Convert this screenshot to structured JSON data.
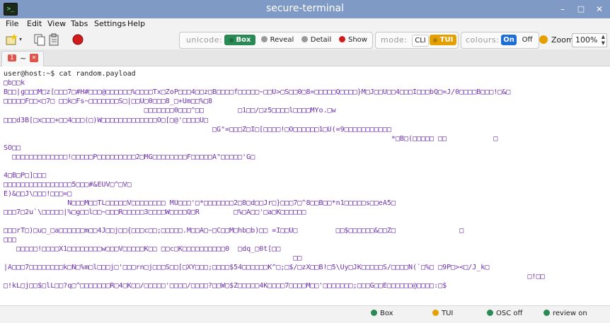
{
  "window": {
    "title": "secure-terminal",
    "minimize": "–",
    "restore": "□",
    "close": "✕"
  },
  "menu": [
    {
      "label": "File"
    },
    {
      "label": "Edit"
    },
    {
      "label": "View"
    },
    {
      "label": "Tabs"
    },
    {
      "label": "Settings"
    },
    {
      "label": "Help"
    }
  ],
  "toolbar": {
    "unicode": {
      "label": "unicode:",
      "box": "Box",
      "reveal": "Reveal",
      "detail": "Detail",
      "show": "Show"
    },
    "mode": {
      "label": "mode:",
      "cli": "CLI",
      "tui": "TUI"
    },
    "colours": {
      "label": "colours:",
      "on": "On",
      "off": "Off"
    },
    "zoom": {
      "label": "Zoom",
      "value": "100%"
    }
  },
  "tab": {
    "number": "1",
    "name": "~",
    "close": "✕"
  },
  "terminal": {
    "lines": [
      "user@host:~$ cat random.payload",
      "□b□□k",
      "B□□|g□□□M□z[□□□7□#H#□□□@□□□□□□%□□□□Tx□ZoP□□□4□□z□B□□□□f□□□□□~□□U>□S□□0□8=□□□□□Q□□□□}M□J□□U□□4□□□I□□□bQ□=J/0□□□□B□□□!□&□",
      "□□□□□F□□<□7□ □□k□Fs~□□□□□□□S□|□□U□0□□□8_□+Um□□%□8",
      "                                 □□□□□□□0□□□^□□        □1□□/□z5□□□□l□□□□MYo.□w",
      "□□□d3B[□x□□□+□□4□□□(□)W□□□□□□□□□□□□□O□[□@'□□□□U□",
      "                                                 □G\"=□□□Z□I□[□□□□!□O□□□□□□1□U(=9□□□□□□□□□□□",
      "                                                                                           *□B□(□□□□□ □□           □",
      "SO□□",
      "  □□□□□□□□□□□□□!□□□□□P□□□□□□□□□2□MG□□□□□□□□F□□□□□A\"□□□□□'G□",
      "",
      "4□B□P□]□□□",
      "□□□□□□□□□□□□□□□□5□□□#&EUV□^□V□",
      "E)&□□J\\□□□!□□□=□",
      "               N□□□M□□TL□□□□□V□□□□□□□□ MU□□□'□*□□□□□□□2□8□d□□Jr□}□□□7□^8□□B□□*n1□□□□□s□□eA5□",
      "□□□7□2u`\\□□□□□|%□g□□l□□~□□□R□□□□□3□□□□W□□□□Q□R        □%□A□□'□a□K□□□□□□",
      "",
      "□□□rT□)□u□_□a□□□□□□m□□4J□□j□□{□□□c□□;□□□□□.M□□A□~□C□□M□hb□b)□□ =I□□U□         □□$□□□□□□&□□Z□               □",
      "□□□",
      "   □□□□□!□□□□X1□□□□□□□□w□□□V□□□□□K□□ □□c□K□□□□□□□□□□0  □dq_□0t[□□",
      "                                                                    □□",
      "|A□□□7□□□□□□□□k□N□%m□l□□□j□'□□□rn□j□□□S□□[□XY□□□;□□□□$54□□□□□□K^□;□$/□zX□□B!□5\\Uy□JK□□□□□S/□□□□N(`□%□ □9P□><□/J_k□",
      "                                                                                                                           □!□□",
      "□!kL□j□□$□lL□□?q□^□□□□□□□R□4□K□□/□□□□□'□□□□/□□□□?□□W□$Z□□□□□4K□□□□7□□□□M□□'□□□□□□□;□□□G□□E□□□□□□@□□□□:□$"
    ]
  },
  "status": [
    {
      "label": "Box",
      "color": "#2a8a55"
    },
    {
      "label": "TUI",
      "color": "#e5a000"
    },
    {
      "label": "OSC off",
      "color": "#2a8a55"
    },
    {
      "label": "review on",
      "color": "#2a8a55"
    }
  ]
}
